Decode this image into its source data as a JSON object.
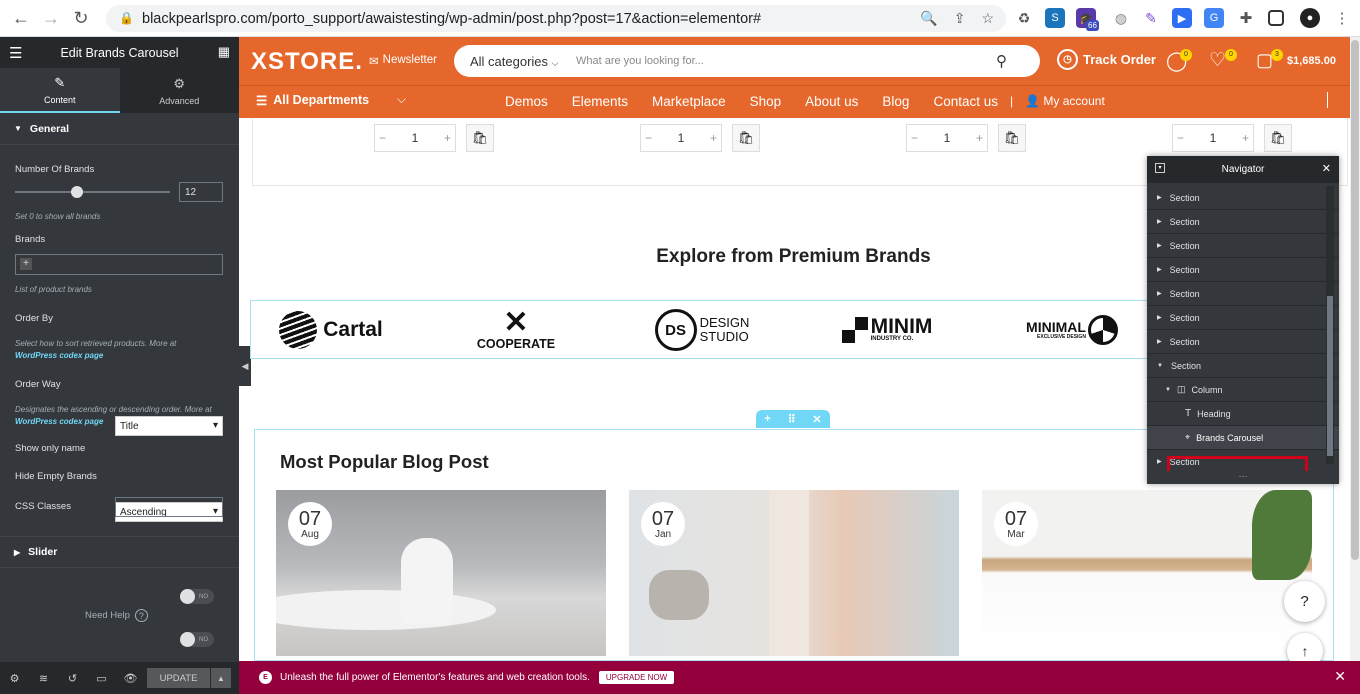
{
  "browser": {
    "url": "blackpearlspro.com/porto_support/awaistesting/wp-admin/post.php?post=17&action=elementor#",
    "ext_badge": "66"
  },
  "panel": {
    "title": "Edit Brands Carousel",
    "tabs": [
      {
        "label": "Content"
      },
      {
        "label": "Advanced"
      }
    ],
    "general_title": "General",
    "number_of_brands_label": "Number Of Brands",
    "number_of_brands_value": "12",
    "number_of_brands_slider": 0.4,
    "number_of_brands_desc": "Set 0 to show all brands",
    "brands_label": "Brands",
    "brands_desc": "List of product brands",
    "order_by_label": "Order By",
    "order_by_value": "Title",
    "order_by_desc": "Select how to sort retrieved products. More at",
    "codex_link": "WordPress codex page",
    "order_way_label": "Order Way",
    "order_way_value": "Ascending",
    "order_way_desc": "Designates the ascending or descending order. More at",
    "show_only_name_label": "Show only name",
    "hide_empty_label": "Hide Empty Brands",
    "toggle_no": "NO",
    "css_classes_label": "CSS Classes",
    "slider_title": "Slider",
    "need_help": "Need Help",
    "update_label": "UPDATE"
  },
  "site": {
    "logo": "XSTORE.",
    "newsletter": "Newsletter",
    "category": "All categories",
    "search_placeholder": "What are you looking for...",
    "track_order": "Track Order",
    "msg_count": "0",
    "wish_count": "0",
    "cart_count": "3",
    "cart_total": "$1,685.00",
    "departments": "All Departments",
    "nav": [
      "Demos",
      "Elements",
      "Marketplace",
      "Shop",
      "About us",
      "Blog",
      "Contact us"
    ],
    "my_account": "My account"
  },
  "qty_value": "1",
  "brands_heading": "Explore from Premium Brands",
  "brands": [
    {
      "name": "Cartal"
    },
    {
      "name": "COOPERATE"
    },
    {
      "name": "DESIGN",
      "sub": "STUDIO",
      "mono": "DS"
    },
    {
      "name": "MINIM",
      "sub": "INDUSTRY CO."
    },
    {
      "name": "MINIMAL",
      "sub": "EXCLUSIVE DESIGN"
    }
  ],
  "blog_heading": "Most Popular Blog Post",
  "posts": [
    {
      "day": "07",
      "month": "Aug"
    },
    {
      "day": "07",
      "month": "Jan"
    },
    {
      "day": "07",
      "month": "Mar"
    }
  ],
  "navigator": {
    "title": "Navigator",
    "items": [
      {
        "label": "Section"
      },
      {
        "label": "Section"
      },
      {
        "label": "Section"
      },
      {
        "label": "Section"
      },
      {
        "label": "Section"
      },
      {
        "label": "Section"
      },
      {
        "label": "Section"
      },
      {
        "label": "Section"
      },
      {
        "label": "Column"
      },
      {
        "label": "Heading"
      },
      {
        "label": "Brands Carousel"
      },
      {
        "label": "Section"
      }
    ]
  },
  "promo": {
    "text": "Unleash the full power of Elementor's features and web creation tools.",
    "button": "UPGRADE NOW"
  },
  "colors": {
    "brand": "#e6672b",
    "panel": "#34383c",
    "promo": "#93003c",
    "accent": "#71d7f7",
    "highlight": "#d0021b"
  }
}
